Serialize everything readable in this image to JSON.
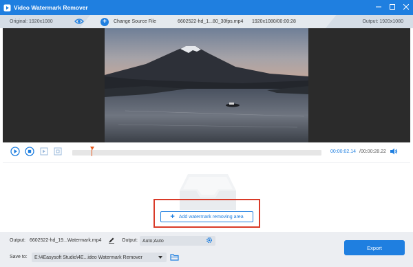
{
  "window": {
    "title": "Video Watermark Remover",
    "app_icon": "play-icon",
    "controls": [
      "minimize-icon",
      "maximize-icon",
      "close-icon"
    ]
  },
  "infobar": {
    "original_label": "Original: 1920x1080",
    "change_source_label": "Change Source File",
    "file_name": "6602522-hd_1...80_30fps.mp4",
    "file_info": "1920x1080/00:00:28",
    "output_label": "Output: 1920x1080"
  },
  "player": {
    "current_time": "00:00:02.14",
    "total_time": "/00:00:28.22",
    "progress_fraction": 0.076
  },
  "work_area": {
    "add_area_label": "Add watermark removing area"
  },
  "bottom": {
    "output_label": "Output:",
    "output_file": "6602522-hd_19...Watermark.mp4",
    "output_format_label": "Output:",
    "output_format_value": "Auto;Auto",
    "save_to_label": "Save to:",
    "save_to_path": "E:\\4Easysoft Studio\\4E...ideo Watermark Remover",
    "export_label": "Export"
  },
  "colors": {
    "accent": "#1f7fe0",
    "highlight": "#d93a28",
    "playhead": "#e65a1e"
  }
}
